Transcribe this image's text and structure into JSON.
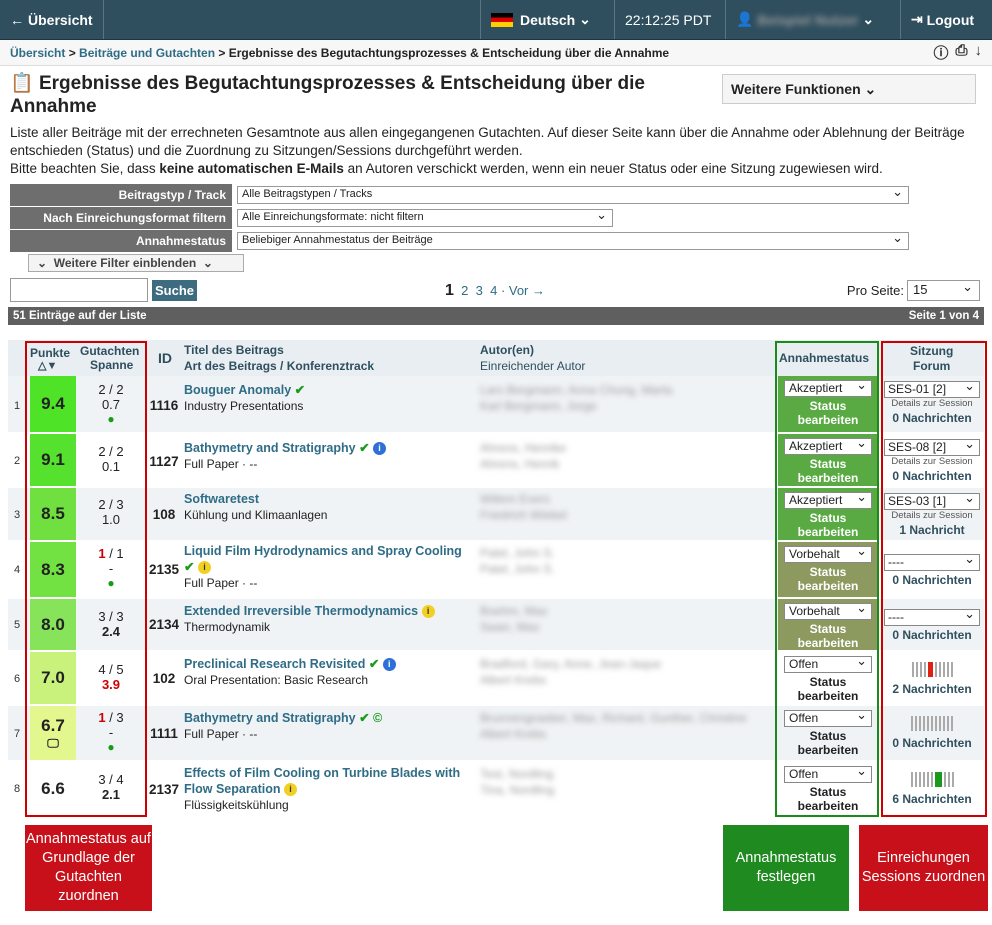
{
  "topbar": {
    "back": "Übersicht",
    "language": "Deutsch",
    "time": "22:12:25  PDT",
    "user": "Beispiel Nutzer",
    "logout": "Logout"
  },
  "breadcrumb": {
    "home": "Übersicht",
    "section": "Beiträge und Gutachten",
    "current": "Ergebnisse des Begutachtungsprozesses & Entscheidung über die Annahme"
  },
  "title": "Ergebnisse des Begutachtungsprozesses & Entscheidung über die Annahme",
  "more_functions": "Weitere Funktionen",
  "intro1": "Liste aller Beiträge mit der errechneten Gesamtnote aus allen eingegangenen Gutachten. Auf dieser Seite kann über die Annahme oder Ablehnung der Beiträge entschieden (Status) und die Zuordnung zu Sitzungen/Sessions durchgeführt werden.",
  "intro2_a": "Bitte beachten Sie, dass ",
  "intro2_b": "keine automatischen E-Mails",
  "intro2_c": " an Autoren verschickt werden, wenn ein neuer Status oder eine Sitzung zugewiesen wird.",
  "filters": [
    {
      "label": "Beitragstyp / Track",
      "value": "Alle Beitragstypen / Tracks"
    },
    {
      "label": "Nach Einreichungsformat filtern",
      "value": "Alle Einreichungsformate: nicht filtern"
    },
    {
      "label": "Annahmestatus",
      "value": "Beliebiger Annahmestatus der Beiträge"
    }
  ],
  "more_filters": "Weitere Filter einblenden",
  "search": {
    "button": "Suche",
    "placeholder": ""
  },
  "pager": {
    "current": "1",
    "p2": "2",
    "p3": "3",
    "p4": "4",
    "next": "· Vor →"
  },
  "per_page": {
    "label": "Pro Seite:",
    "value": "15"
  },
  "count": "51 Einträge auf der Liste",
  "page_of": "Seite 1 von 4",
  "headers": {
    "points": "Punkte",
    "reviews": "Gutachten",
    "range": "Spanne",
    "id": "ID",
    "title": "Titel des Beitrags",
    "subtitle": "Art des Beitrags / Konferenztrack",
    "author": "Autor(en)",
    "submitter": "Einreichender Autor",
    "status": "Annahmestatus",
    "session": "Sitzung",
    "forum": "Forum"
  },
  "rows": [
    {
      "n": "1",
      "score": "9.4",
      "g": "2 / 2",
      "sp": "0.7",
      "id": "1116",
      "title": "Bouguer Anomaly",
      "type": "Industry Presentations",
      "author": "Lars Bergmann, Anna Chung, Marta",
      "sub": "Karl Bergmann, Jorge",
      "status": "Akzeptiert",
      "action": "Status bearbeiten",
      "sess": "SES-01 [2]",
      "details": "Details zur Session",
      "msgs": "0 Nachrichten"
    },
    {
      "n": "2",
      "score": "9.1",
      "g": "2 / 2",
      "sp": "0.1",
      "id": "1127",
      "title": "Bathymetry and Stratigraphy",
      "type": "Full Paper · --",
      "author": "Ahrens, Henrike",
      "sub": "Ahrens, Henrik",
      "status": "Akzeptiert",
      "action": "Status bearbeiten",
      "sess": "SES-08 [2]",
      "details": "Details zur Session",
      "msgs": "0 Nachrichten"
    },
    {
      "n": "3",
      "score": "8.5",
      "g": "2 / 3",
      "sp": "1.0",
      "id": "108",
      "title": "Softwaretest",
      "type": "Kühlung und Klimaanlagen",
      "author": "Willem Evers",
      "sub": "Friedrich Wiebel",
      "status": "Akzeptiert",
      "action": "Status bearbeiten",
      "sess": "SES-03 [1]",
      "details": "Details zur Session",
      "msgs": "1 Nachricht"
    },
    {
      "n": "4",
      "score": "8.3",
      "g1": "1",
      "g2": " / 1",
      "sp": "-",
      "id": "2135",
      "title": "Liquid Film Hydrodynamics and Spray Cooling",
      "type": "Full Paper · --",
      "author": "Patel, John S.",
      "sub": "Patel, John S.",
      "status": "Vorbehalt",
      "action": "Status bearbeiten",
      "sess": "----",
      "msgs": "0 Nachrichten"
    },
    {
      "n": "5",
      "score": "8.0",
      "g": "3 / 3",
      "sp": "2.4",
      "id": "2134",
      "title": "Extended Irreversible Thermodynamics",
      "type": "Thermodynamik",
      "author": "Boehm, Max",
      "sub": "Swan, Max",
      "status": "Vorbehalt",
      "action": "Status bearbeiten",
      "sess": "----",
      "msgs": "0 Nachrichten"
    },
    {
      "n": "6",
      "score": "7.0",
      "g": "4 / 5",
      "sp": "3.9",
      "id": "102",
      "title": "Preclinical Research Revisited",
      "type": "Oral Presentation: Basic Research",
      "author": "Bradford, Gary, Anne, Jean-Jaque",
      "sub": "Albert Krebs",
      "status": "Offen",
      "action": "Status bearbeiten",
      "msgs": "2 Nachrichten"
    },
    {
      "n": "7",
      "score": "6.7",
      "g1": "1",
      "g2": " / 3",
      "sp": "-",
      "id": "1111",
      "title": "Bathymetry and Stratigraphy",
      "type": "Full Paper · --",
      "author": "Brunnengraeber, Max, Richard, Gunther, Christine",
      "sub": "Albert Krebs",
      "status": "Offen",
      "action": "Status bearbeiten",
      "msgs": "0 Nachrichten"
    },
    {
      "n": "8",
      "score": "6.6",
      "g": "3 / 4",
      "sp": "2.1",
      "id": "2137",
      "title": "Effects of Film Cooling on Turbine Blades with Flow Separation",
      "type": "Flüssigkeitskühlung",
      "author": "Test, Nordling",
      "sub": "Tina, Nordling",
      "status": "Offen",
      "action": "Status bearbeiten",
      "msgs": "6 Nachrichten"
    }
  ],
  "callouts": {
    "left": "Annahmestatus auf Grundlage der Gutachten zuordnen",
    "mid": "Annahmestatus festlegen",
    "right": "Einreichungen Sessions zuordnen"
  },
  "colors": {
    "topbar": "#2f4f5f",
    "accept": "#5aaa43",
    "reserve": "#8c9a60",
    "callout_red": "#c8101a",
    "callout_green": "#1f8a1f"
  }
}
